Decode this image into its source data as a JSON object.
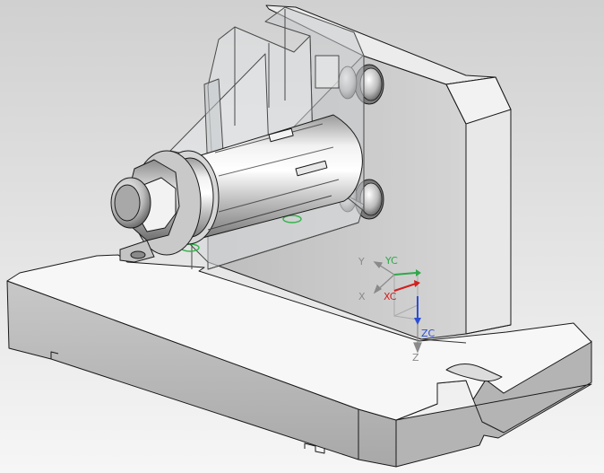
{
  "viewport": {
    "background_top": "#d4d4d4",
    "background_bottom": "#f4f4f4"
  },
  "triad": {
    "wcs_axes": {
      "y": "Y",
      "x": "X",
      "z": "Z"
    },
    "csys_axes": {
      "yc": "YC",
      "xc": "XC",
      "zc": "ZC"
    },
    "colors": {
      "wcs": "#8a8a8a",
      "yc": "#2fa84a",
      "xc": "#d11f1f",
      "zc": "#2b4fd6"
    }
  },
  "model": {
    "part_fill": "#e6e6e6",
    "part_edge": "#1a1a1a",
    "transparent_fill": "#cfd3d6",
    "hole_highlight": "#34b34a"
  }
}
